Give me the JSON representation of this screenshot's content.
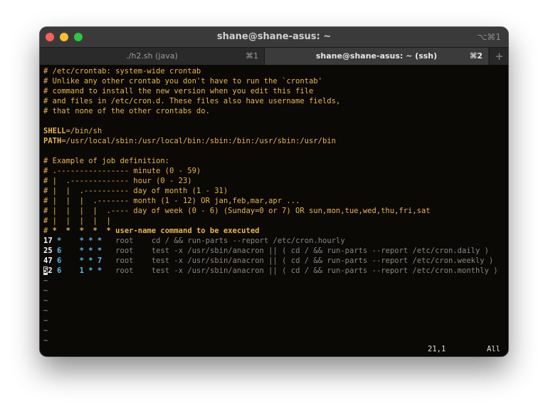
{
  "window": {
    "title": "shane@shane-asus: ~",
    "title_shortcut": "⌥⌘1"
  },
  "tabs": [
    {
      "label": "./h2.sh (java)",
      "shortcut": "⌘1",
      "active": false
    },
    {
      "label": "shane@shane-asus: ~ (ssh)",
      "shortcut": "⌘2",
      "active": true
    }
  ],
  "tab_add_label": "+",
  "editor": {
    "comments_header": [
      "# /etc/crontab: system-wide crontab",
      "# Unlike any other crontab you don't have to run the `crontab'",
      "# command to install the new version when you edit this file",
      "# and files in /etc/cron.d. These files also have username fields,",
      "# that none of the other crontabs do."
    ],
    "shell_name": "SHELL",
    "shell_value": "=/bin/sh",
    "path_name": "PATH",
    "path_value": "=/usr/local/sbin:/usr/local/bin:/sbin:/bin:/usr/sbin:/usr/bin",
    "job_definition": [
      "# Example of job definition:",
      "# .---------------- minute (0 - 59)",
      "# |  .------------- hour (0 - 23)",
      "# |  |  .---------- day of month (1 - 31)",
      "# |  |  |  .------- month (1 - 12) OR jan,feb,mar,apr ...",
      "# |  |  |  |  .---- day of week (0 - 6) (Sunday=0 or 7) OR sun,mon,tue,wed,thu,fri,sat",
      "# |  |  |  |  |"
    ],
    "header_prefix": "#",
    "header_stars": "*  *  *  *  *",
    "header_suffix": "user-name command to be executed",
    "cron_rows": [
      {
        "minute": "17",
        "hour": "*",
        "dom": "*",
        "mon": "*",
        "dow": "*",
        "user": "root",
        "command": "cd / && run-parts --report /etc/cron.hourly"
      },
      {
        "minute": "25",
        "hour": "6",
        "dom": "*",
        "mon": "*",
        "dow": "*",
        "user": "root",
        "command": "test -x /usr/sbin/anacron || ( cd / && run-parts --report /etc/cron.daily )"
      },
      {
        "minute": "47",
        "hour": "6",
        "dom": "*",
        "mon": "*",
        "dow": "7",
        "user": "root",
        "command": "test -x /usr/sbin/anacron || ( cd / && run-parts --report /etc/cron.weekly )"
      },
      {
        "minute": "52",
        "hour": "6",
        "dom": "1",
        "mon": "*",
        "dow": "*",
        "user": "root",
        "command": "test -x /usr/sbin/anacron || ( cd / && run-parts --report /etc/cron.monthly )"
      }
    ],
    "empty_line_marker": "~",
    "empty_line_count": 7,
    "status_position": "21,1",
    "status_scroll": "All"
  },
  "colors": {
    "comment": "#e8b64c",
    "star": "#57b8e8",
    "dim": "#8a8680",
    "background": "#0b0906"
  }
}
